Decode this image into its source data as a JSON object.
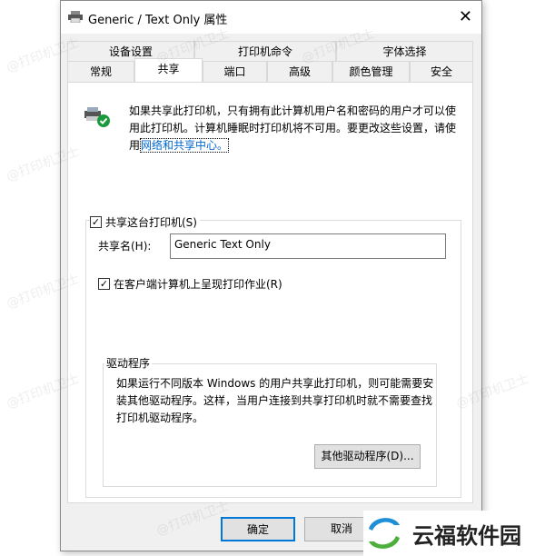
{
  "window": {
    "title": "Generic / Text Only 属性",
    "close_label": "✕"
  },
  "tabs_row1": [
    "设备设置",
    "打印机命令",
    "字体选择"
  ],
  "tabs_row2": [
    "常规",
    "共享",
    "端口",
    "高级",
    "颜色管理",
    "安全"
  ],
  "active_tab": "共享",
  "sharing": {
    "description": "如果共享此打印机，只有拥有此计算机用户名和密码的用户才可以使用此打印机。计算机睡眠时打印机将不可用。要更改这些设置，请使用",
    "link": "网络和共享中心。",
    "share_checkbox": "共享这台打印机(S)",
    "share_checked": true,
    "share_name_label": "共享名(H):",
    "share_name_value": "Generic  Text Only",
    "render_checkbox": "在客户端计算机上呈现打印作业(R)",
    "render_checked": true,
    "drivers_group": "驱动程序",
    "drivers_text": "如果运行不同版本 Windows 的用户共享此打印机，则可能需要安装其他驱动程序。这样，当用户连接到共享打印机时就不需要查找打印机驱动程序。",
    "drivers_button": "其他驱动程序(D)..."
  },
  "footer": {
    "ok": "确定",
    "cancel": "取消"
  },
  "watermark": "@打印机卫士",
  "logo_text": "云福软件园",
  "colors": {
    "link": "#0066cc",
    "focus": "#0078d7",
    "logo_blue": "#1e8fd6",
    "logo_green": "#4caf3c"
  }
}
